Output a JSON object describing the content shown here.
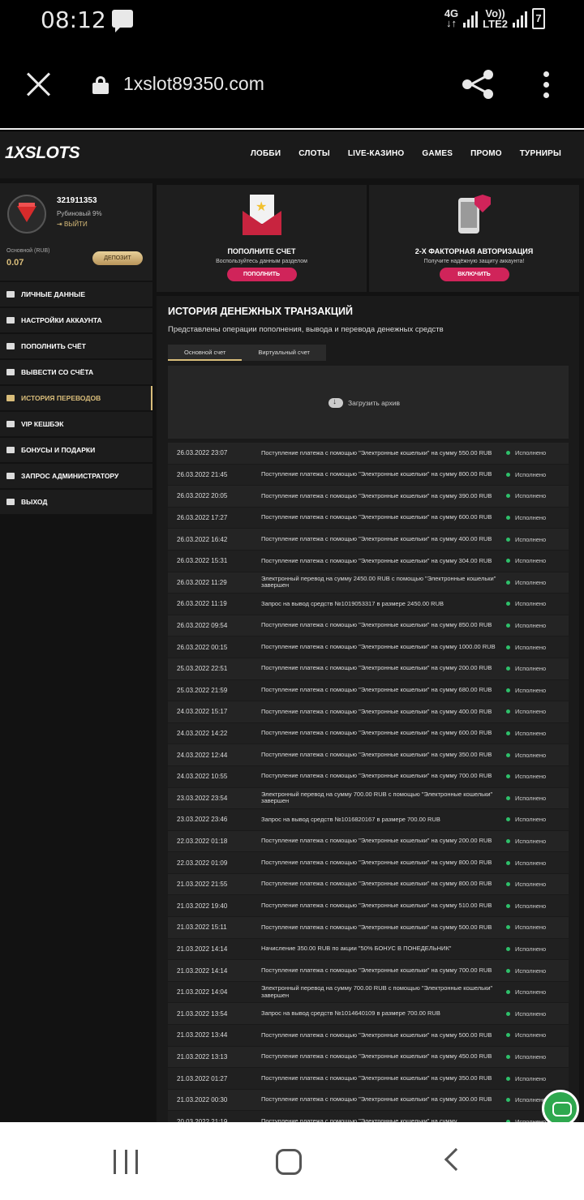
{
  "status_bar": {
    "time": "08:12",
    "net": "4G",
    "volte_top": "Vo))",
    "volte_bottom": "LTE2",
    "battery": "7"
  },
  "browser": {
    "url": "1xslot89350.com"
  },
  "site": {
    "logo": "1XSLOTS",
    "nav": [
      "ЛОББИ",
      "СЛОТЫ",
      "LIVE-КАЗИНО",
      "GAMES",
      "ПРОМО",
      "ТУРНИРЫ"
    ]
  },
  "profile": {
    "user_id": "321911353",
    "rank": "Рубиновый 9%",
    "logout": "ВЫЙТИ",
    "account_label": "Основной (RUB)",
    "balance": "0.07",
    "deposit_label": "ДЕПОЗИТ"
  },
  "menu": [
    "ЛИЧНЫЕ ДАННЫЕ",
    "НАСТРОЙКИ АККАУНТА",
    "ПОПОЛНИТЬ СЧЁТ",
    "ВЫВЕСТИ СО СЧЁТА",
    "ИСТОРИЯ ПЕРЕВОДОВ",
    "VIP КЕШБЭК",
    "БОНУСЫ И ПОДАРКИ",
    "ЗАПРОС АДМИНИСТРАТОРУ",
    "ВЫХОД"
  ],
  "cards": {
    "topup": {
      "title": "ПОПОЛНИТЕ СЧЕТ",
      "subtitle": "Воспользуйтесь данным разделом",
      "button": "ПОПОЛНИТЬ"
    },
    "twofa": {
      "title": "2-Х ФАКТОРНАЯ АВТОРИЗАЦИЯ",
      "subtitle": "Получите надёжную защиту аккаунта!",
      "button": "ВКЛЮЧИТЬ"
    }
  },
  "history": {
    "title": "ИСТОРИЯ ДЕНЕЖНЫХ ТРАНЗАКЦИЙ",
    "subtitle": "Представлены операции пополнения, вывода и перевода денежных средств",
    "tabs": [
      "Основной счет",
      "Виртуальный счет"
    ],
    "archive_label": "Загрузить архив",
    "rows": [
      {
        "date": "26.03.2022 23:07",
        "desc": "Поступление платежа с помощью \"Электронные кошельки\" на сумму 550.00 RUB",
        "status": "Исполнено"
      },
      {
        "date": "26.03.2022 21:45",
        "desc": "Поступление платежа с помощью \"Электронные кошельки\" на сумму 800.00 RUB",
        "status": "Исполнено"
      },
      {
        "date": "26.03.2022 20:05",
        "desc": "Поступление платежа с помощью \"Электронные кошельки\" на сумму 390.00 RUB",
        "status": "Исполнено"
      },
      {
        "date": "26.03.2022 17:27",
        "desc": "Поступление платежа с помощью \"Электронные кошельки\" на сумму 600.00 RUB",
        "status": "Исполнено"
      },
      {
        "date": "26.03.2022 16:42",
        "desc": "Поступление платежа с помощью \"Электронные кошельки\" на сумму 400.00 RUB",
        "status": "Исполнено"
      },
      {
        "date": "26.03.2022 15:31",
        "desc": "Поступление платежа с помощью \"Электронные кошельки\" на сумму 304.00 RUB",
        "status": "Исполнено"
      },
      {
        "date": "26.03.2022 11:29",
        "desc": "Электронный перевод на сумму 2450.00 RUB с помощью \"Электронные кошельки\" завершен",
        "status": "Исполнено"
      },
      {
        "date": "26.03.2022 11:19",
        "desc": "Запрос на вывод средств №1019053317 в размере 2450.00 RUB",
        "status": "Исполнено"
      },
      {
        "date": "26.03.2022 09:54",
        "desc": "Поступление платежа с помощью \"Электронные кошельки\" на сумму 850.00 RUB",
        "status": "Исполнено"
      },
      {
        "date": "26.03.2022 00:15",
        "desc": "Поступление платежа с помощью \"Электронные кошельки\" на сумму 1000.00 RUB",
        "status": "Исполнено"
      },
      {
        "date": "25.03.2022 22:51",
        "desc": "Поступление платежа с помощью \"Электронные кошельки\" на сумму 200.00 RUB",
        "status": "Исполнено"
      },
      {
        "date": "25.03.2022 21:59",
        "desc": "Поступление платежа с помощью \"Электронные кошельки\" на сумму 680.00 RUB",
        "status": "Исполнено"
      },
      {
        "date": "24.03.2022 15:17",
        "desc": "Поступление платежа с помощью \"Электронные кошельки\" на сумму 400.00 RUB",
        "status": "Исполнено"
      },
      {
        "date": "24.03.2022 14:22",
        "desc": "Поступление платежа с помощью \"Электронные кошельки\" на сумму 600.00 RUB",
        "status": "Исполнено"
      },
      {
        "date": "24.03.2022 12:44",
        "desc": "Поступление платежа с помощью \"Электронные кошельки\" на сумму 350.00 RUB",
        "status": "Исполнено"
      },
      {
        "date": "24.03.2022 10:55",
        "desc": "Поступление платежа с помощью \"Электронные кошельки\" на сумму 700.00 RUB",
        "status": "Исполнено"
      },
      {
        "date": "23.03.2022 23:54",
        "desc": "Электронный перевод на сумму 700.00 RUB с помощью \"Электронные кошельки\" завершен",
        "status": "Исполнено"
      },
      {
        "date": "23.03.2022 23:46",
        "desc": "Запрос на вывод средств №1016820167 в размере 700.00 RUB",
        "status": "Исполнено"
      },
      {
        "date": "22.03.2022 01:18",
        "desc": "Поступление платежа с помощью \"Электронные кошельки\" на сумму 200.00 RUB",
        "status": "Исполнено"
      },
      {
        "date": "22.03.2022 01:09",
        "desc": "Поступление платежа с помощью \"Электронные кошельки\" на сумму 800.00 RUB",
        "status": "Исполнено"
      },
      {
        "date": "21.03.2022 21:55",
        "desc": "Поступление платежа с помощью \"Электронные кошельки\" на сумму 800.00 RUB",
        "status": "Исполнено"
      },
      {
        "date": "21.03.2022 19:40",
        "desc": "Поступление платежа с помощью \"Электронные кошельки\" на сумму 510.00 RUB",
        "status": "Исполнено"
      },
      {
        "date": "21.03.2022 15:11",
        "desc": "Поступление платежа с помощью \"Электронные кошельки\" на сумму 500.00 RUB",
        "status": "Исполнено"
      },
      {
        "date": "21.03.2022 14:14",
        "desc": "Начисление 350.00 RUB по акции \"50% БОНУС В ПОНЕДЕЛЬНИК\"",
        "status": "Исполнено"
      },
      {
        "date": "21.03.2022 14:14",
        "desc": "Поступление платежа с помощью \"Электронные кошельки\" на сумму 700.00 RUB",
        "status": "Исполнено"
      },
      {
        "date": "21.03.2022 14:04",
        "desc": "Электронный перевод на сумму 700.00 RUB с помощью \"Электронные кошельки\" завершен",
        "status": "Исполнено"
      },
      {
        "date": "21.03.2022 13:54",
        "desc": "Запрос на вывод средств №1014640109 в размере 700.00 RUB",
        "status": "Исполнено"
      },
      {
        "date": "21.03.2022 13:44",
        "desc": "Поступление платежа с помощью \"Электронные кошельки\" на сумму 500.00 RUB",
        "status": "Исполнено"
      },
      {
        "date": "21.03.2022 13:13",
        "desc": "Поступление платежа с помощью \"Электронные кошельки\" на сумму 450.00 RUB",
        "status": "Исполнено"
      },
      {
        "date": "21.03.2022 01:27",
        "desc": "Поступление платежа с помощью \"Электронные кошельки\" на сумму 350.00 RUB",
        "status": "Исполнено"
      },
      {
        "date": "21.03.2022 00:30",
        "desc": "Поступление платежа с помощью \"Электронные кошельки\" на сумму 300.00 RUB",
        "status": "Исполнено"
      },
      {
        "date": "20.03.2022 21:19",
        "desc": "Поступление платежа с помощью \"Электронные кошельки\" на сумму",
        "status": "Исполнено"
      }
    ]
  },
  "colors": {
    "accent_gold": "#d9bd7a",
    "accent_pink": "#d0245a",
    "status_green": "#2ec06a"
  }
}
